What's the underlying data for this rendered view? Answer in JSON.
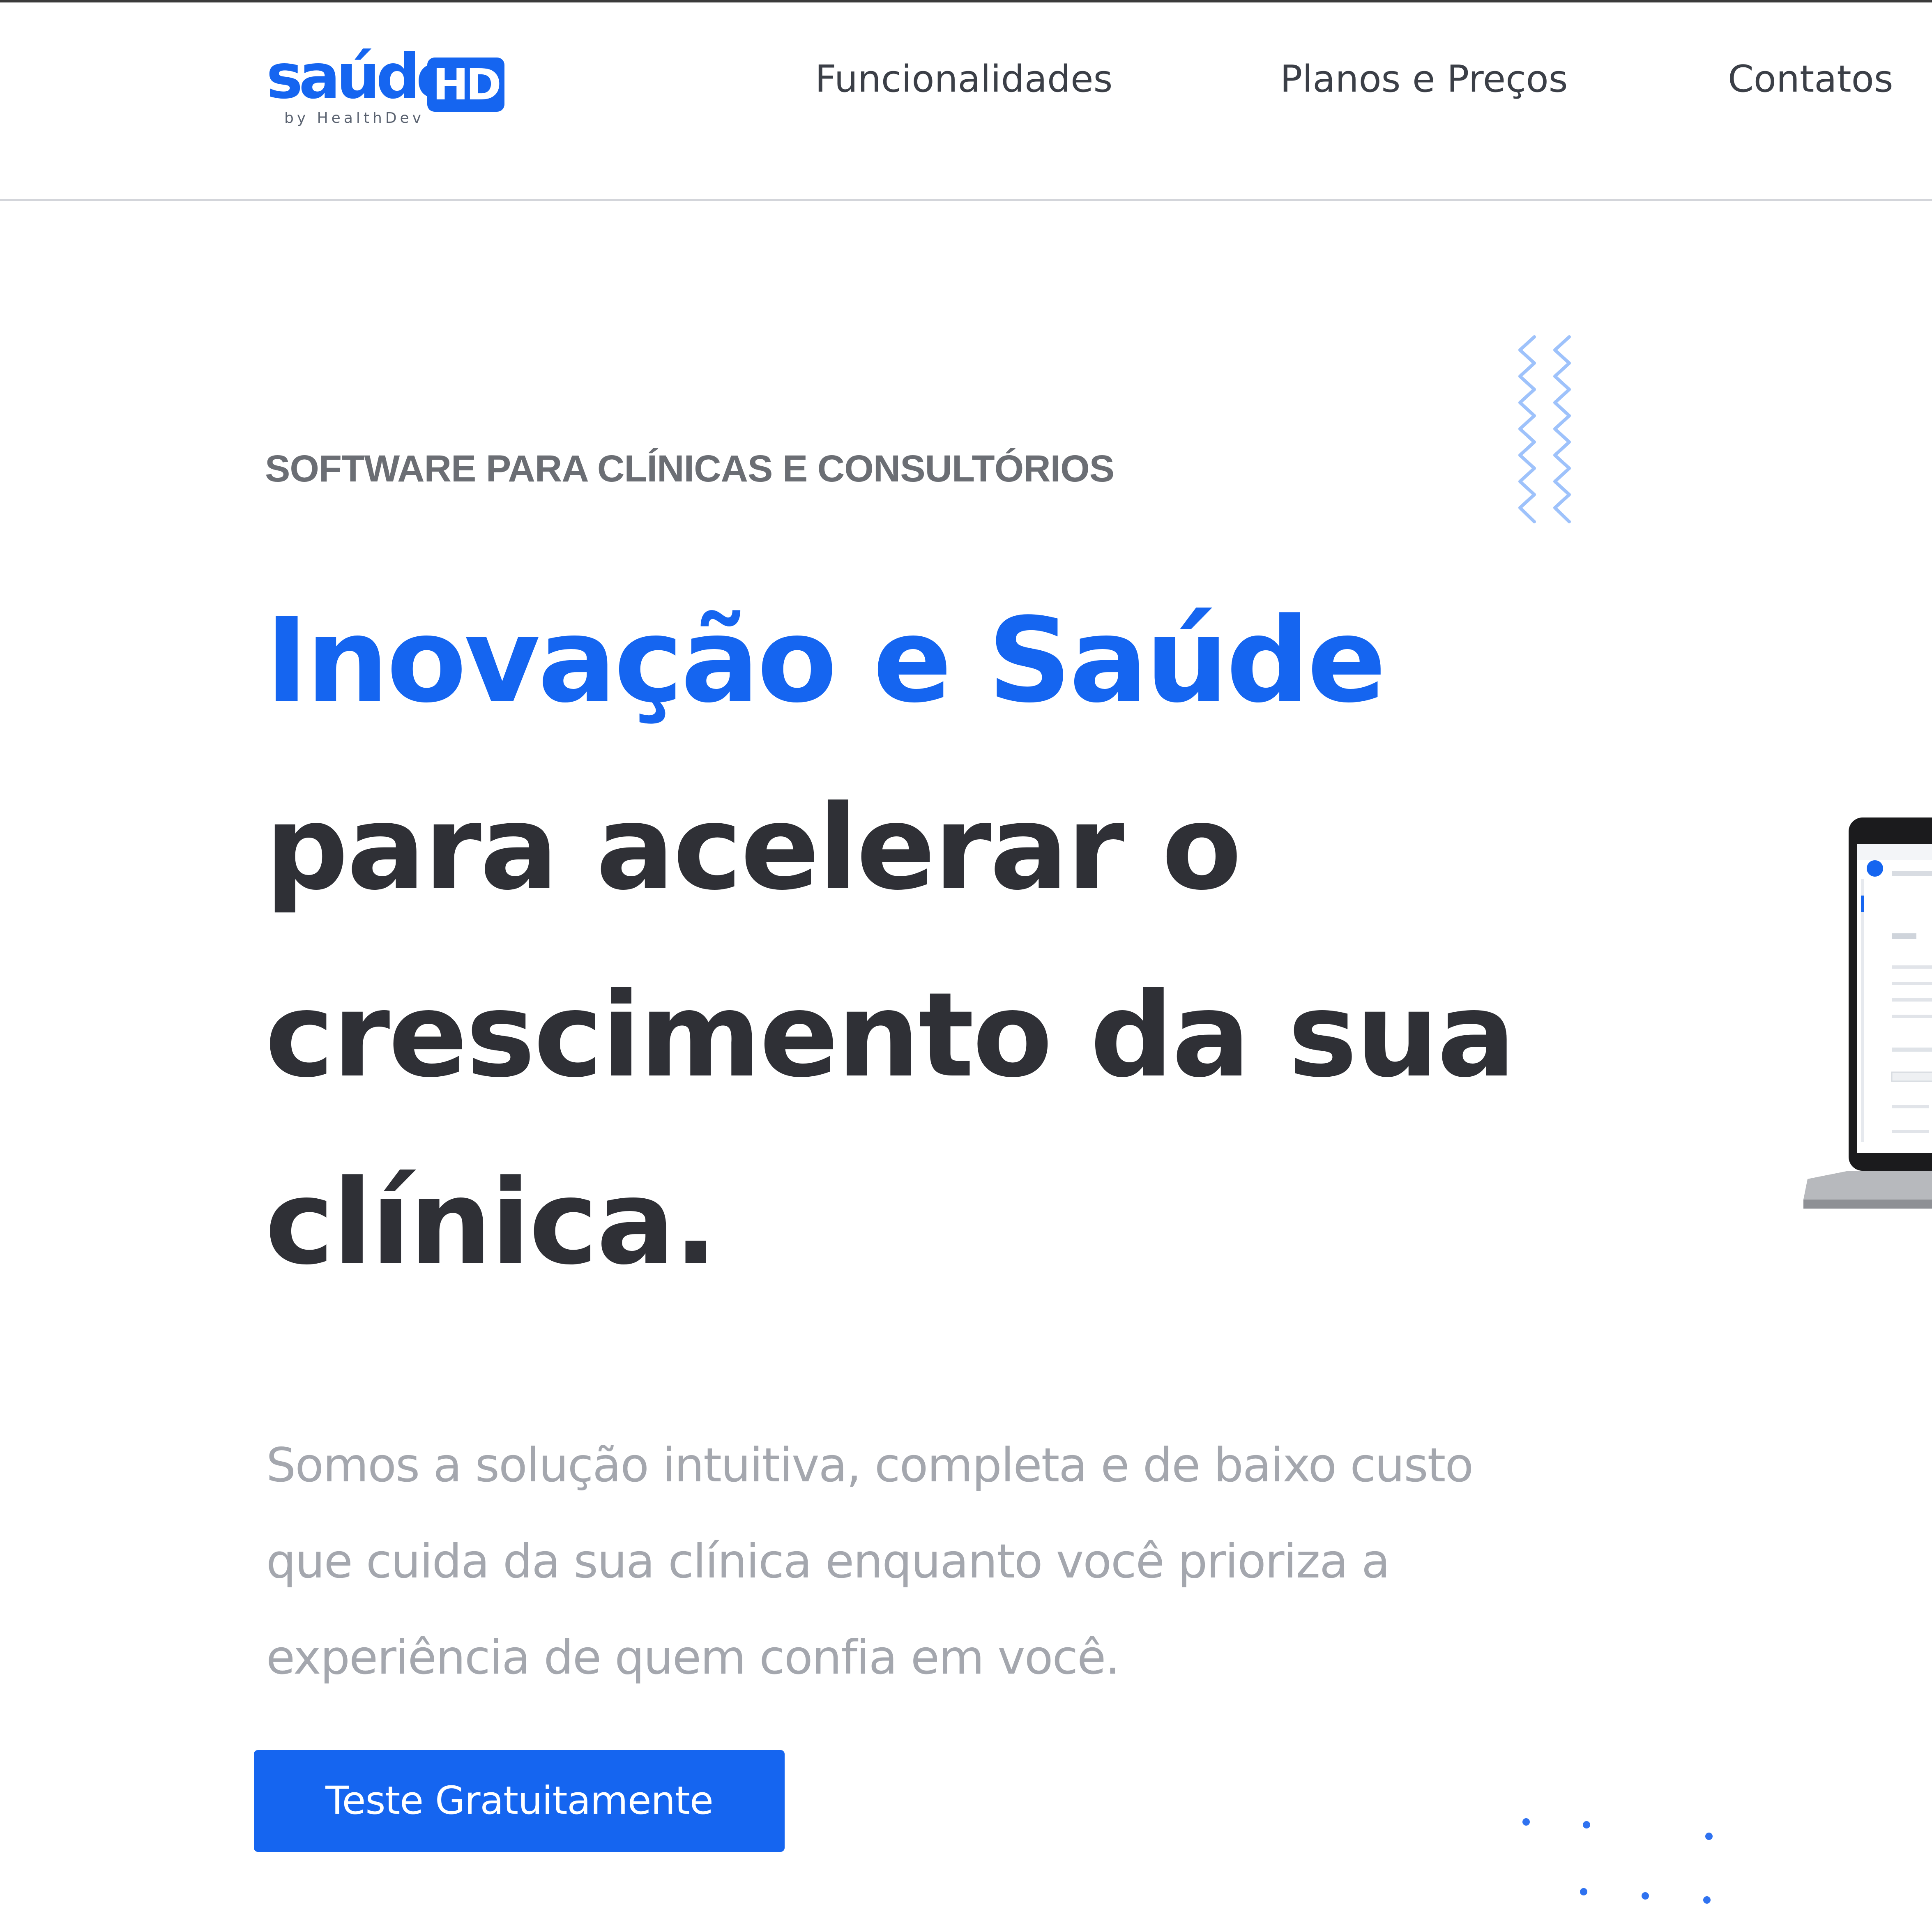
{
  "header": {
    "logo": {
      "word": "saúde",
      "badge": "HD",
      "tagline": "by HealthDev"
    },
    "nav": {
      "funcionalidades": "Funcionalidades",
      "planos": "Planos e Preços",
      "contatos": "Contatos"
    }
  },
  "hero": {
    "eyebrow": "SOFTWARE PARA CLÍNICAS E CONSULTÓRIOS",
    "headline_highlight": "Inovação e Saúde",
    "headline_lines": [
      "para acelerar o",
      "crescimento da sua",
      "clínica."
    ],
    "subcopy_lines": [
      "Somos a solução intuitiva, completa e de baixo custo",
      "que cuida da sua clínica enquanto você prioriza a",
      "experiência de quem confia em você."
    ],
    "cta_label": "Teste Gratuitamente"
  },
  "colors": {
    "brand": "#1565f0",
    "text_dark": "#2f3036",
    "text_muted": "#a4a7ae",
    "eyebrow": "#6b6e74",
    "header_border": "#d3d5da"
  },
  "icons": {
    "zigzag": "zigzag-decoration-icon",
    "dots": "dot-grid-decoration-icon",
    "laptop": "laptop-mockup-image"
  }
}
